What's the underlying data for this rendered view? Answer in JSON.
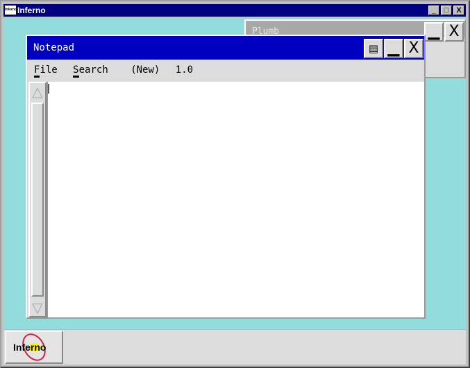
{
  "outer_window": {
    "title": "Inferno",
    "icon": "inferno-app-icon",
    "buttons": {
      "minimize": "_",
      "maximize": "□",
      "close": "X"
    }
  },
  "plumb_window": {
    "title": "Plumb",
    "buttons": {
      "maximize": "▁",
      "close": "X"
    }
  },
  "notepad": {
    "title": "Notepad",
    "buttons": {
      "restore": "▤",
      "maximize": "▁",
      "close": "X"
    },
    "menu": {
      "file_hotkey": "F",
      "file_rest": "ile",
      "search_hotkey": "S",
      "search_rest": "earch",
      "status": "(New)",
      "version": "1.0"
    },
    "scrollbar": {
      "up": "△",
      "down": "▽"
    },
    "content": ""
  },
  "taskbar": {
    "start_logo_text": "Inferno"
  }
}
